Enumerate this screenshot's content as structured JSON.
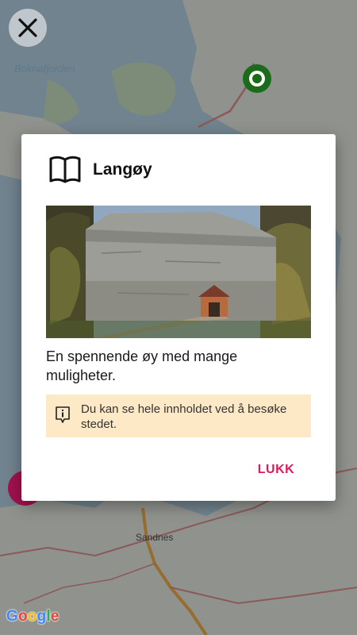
{
  "map": {
    "place_labels": {
      "fjord": "Boknafjorden",
      "city": "Sandnes"
    },
    "attribution": "Google",
    "colors": {
      "land": "#e9ece6",
      "water": "#b7d3e6",
      "park": "#c9e3c2",
      "road_major": "#e38f8f",
      "road_highway": "#f2b04c",
      "marker_green": "#1a6b1a",
      "marker_pink": "#a0124e"
    }
  },
  "close_button": {
    "icon": "close-icon"
  },
  "dialog": {
    "icon": "book-icon",
    "title": "Langøy",
    "image_alt": "Stone fortress tower with wooden boardwalk",
    "description": "En spennende øy med mange muligheter.",
    "info": {
      "icon": "info-icon",
      "text": "Du kan se hele innholdet ved å besøke stedet.",
      "background": "#fde9c6"
    },
    "close_label": "LUKK",
    "accent_color": "#e0195d"
  }
}
